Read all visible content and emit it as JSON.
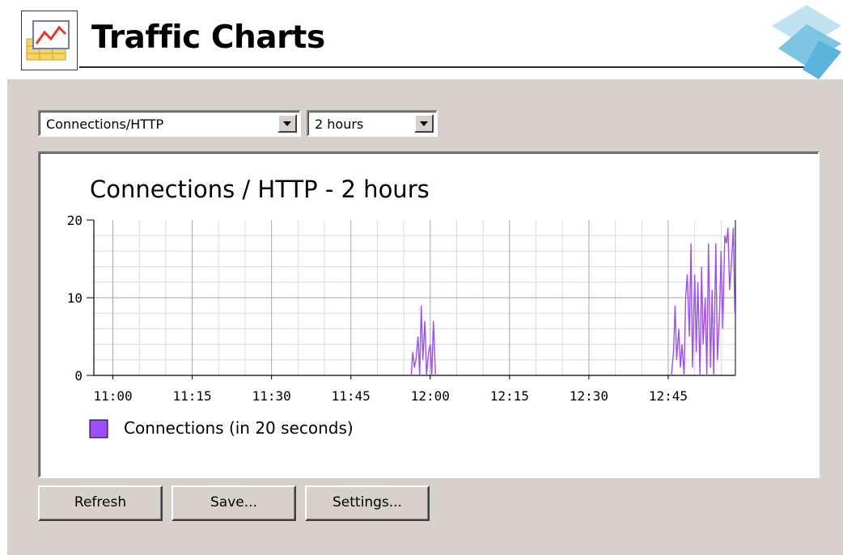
{
  "header": {
    "title": "Traffic Charts",
    "app_icon": "traffic-chart-icon",
    "brand_logo": "brand-logo"
  },
  "controls": {
    "metric_select": {
      "value": "Connections/HTTP"
    },
    "range_select": {
      "value": "2 hours"
    }
  },
  "chart_data": {
    "type": "line",
    "title": "Connections / HTTP - 2 hours",
    "xlabel": "",
    "ylabel": "",
    "ylim": [
      0,
      20
    ],
    "yticks": [
      "0",
      "10",
      "20"
    ],
    "xticks": [
      "11:00",
      "11:15",
      "11:30",
      "11:45",
      "12:00",
      "12:15",
      "12:30",
      "12:45"
    ],
    "xrange_minutes_from_1100": [
      -3.6,
      117.7
    ],
    "grid": true,
    "legend_position": "bottom-left",
    "series": [
      {
        "name": "Connections (in 20 seconds)",
        "color": "#9b4dff",
        "points": [
          [
            56.4,
            0
          ],
          [
            56.7,
            3
          ],
          [
            57.0,
            1
          ],
          [
            57.3,
            2
          ],
          [
            57.7,
            5
          ],
          [
            58.0,
            0
          ],
          [
            58.3,
            9
          ],
          [
            58.6,
            2
          ],
          [
            59.0,
            7
          ],
          [
            59.3,
            0
          ],
          [
            59.7,
            3
          ],
          [
            60.0,
            4
          ],
          [
            60.3,
            0
          ],
          [
            60.6,
            7
          ],
          [
            61.0,
            0
          ],
          [
            105.6,
            0
          ],
          [
            106.0,
            3
          ],
          [
            106.3,
            9
          ],
          [
            106.6,
            2
          ],
          [
            107.0,
            6
          ],
          [
            107.3,
            1
          ],
          [
            107.6,
            4
          ],
          [
            108.0,
            0
          ],
          [
            108.3,
            10
          ],
          [
            108.6,
            13
          ],
          [
            109.0,
            5
          ],
          [
            109.3,
            17
          ],
          [
            109.6,
            1
          ],
          [
            110.0,
            13
          ],
          [
            110.3,
            3
          ],
          [
            110.6,
            12
          ],
          [
            111.0,
            0
          ],
          [
            111.3,
            14
          ],
          [
            111.6,
            4
          ],
          [
            112.0,
            10
          ],
          [
            112.3,
            0
          ],
          [
            112.6,
            17
          ],
          [
            113.0,
            1
          ],
          [
            113.3,
            11
          ],
          [
            113.6,
            0
          ],
          [
            114.0,
            17
          ],
          [
            114.3,
            2
          ],
          [
            114.7,
            8
          ],
          [
            115.0,
            16
          ],
          [
            115.3,
            6
          ],
          [
            115.7,
            18
          ],
          [
            116.0,
            17
          ],
          [
            116.3,
            19
          ],
          [
            116.6,
            11
          ],
          [
            117.0,
            15
          ],
          [
            117.3,
            19
          ],
          [
            117.6,
            8
          ]
        ]
      }
    ]
  },
  "buttons": {
    "refresh": "Refresh",
    "save": "Save...",
    "settings": "Settings..."
  }
}
